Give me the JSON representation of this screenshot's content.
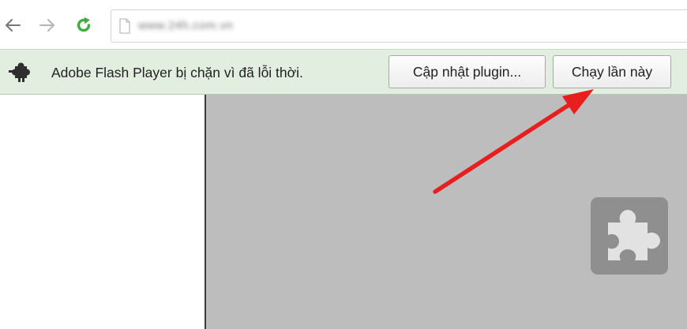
{
  "browser": {
    "url": "www.24h.com.vn"
  },
  "infobar": {
    "message": "Adobe Flash Player bị chặn vì đã lỗi thời.",
    "update_button": "Cập nhật plugin...",
    "run_button": "Chạy lần này"
  },
  "icons": {
    "back": "arrow-left-icon",
    "forward": "arrow-right-icon",
    "reload": "reload-icon",
    "page": "page-icon",
    "plugin": "puzzle-piece-icon",
    "plugin_placeholder": "puzzle-piece-icon",
    "annotation": "red-arrow"
  },
  "colors": {
    "infobar_bg": "#e2eee0",
    "reload_green": "#3dae3f",
    "plugin_area_bg": "#bdbdbd",
    "annotation_red": "#e81f1f"
  }
}
